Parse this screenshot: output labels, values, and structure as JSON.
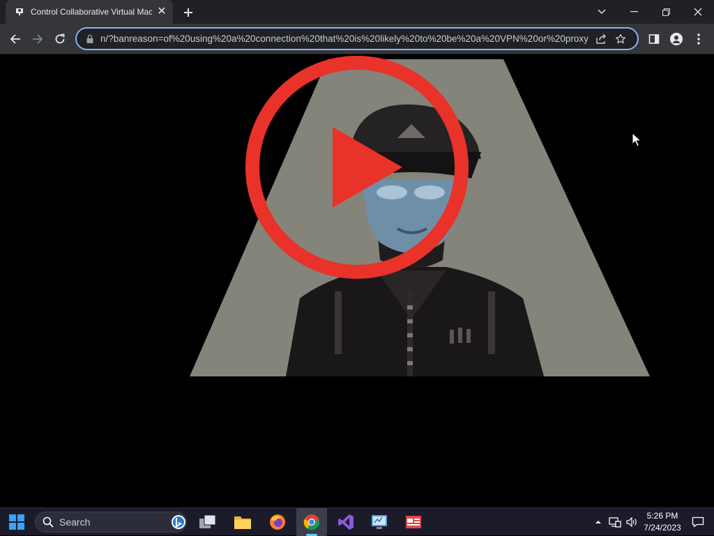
{
  "browser": {
    "tab": {
      "title": "Control Collaborative Virtual Machine",
      "close_label": "✕"
    },
    "new_tab_label": "+",
    "address_bar": {
      "url": "n/?banreason=of%20using%20a%20connection%20that%20is%20likely%20to%20be%20a%20VPN%20or%20proxy"
    }
  },
  "taskbar": {
    "search_label": "Search",
    "clock": {
      "time": "5:26 PM",
      "date": "7/24/2023"
    }
  },
  "colors": {
    "accent": "#8ab4f8",
    "play_button": "#e8322a",
    "spotlight": "#85847a"
  }
}
